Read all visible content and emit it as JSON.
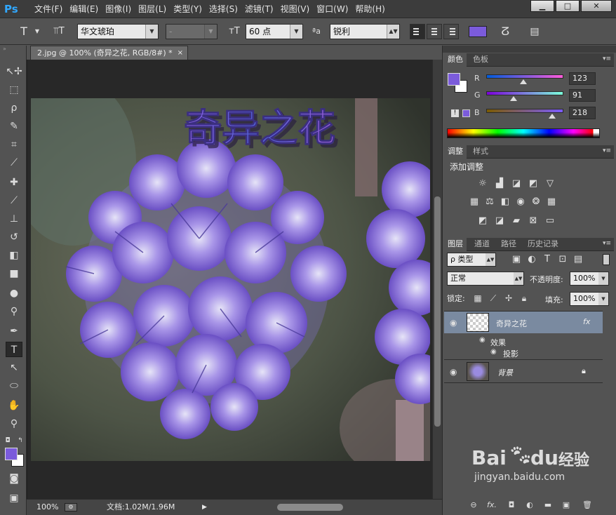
{
  "app": {
    "logo": "Ps"
  },
  "menu": [
    "文件(F)",
    "编辑(E)",
    "图像(I)",
    "图层(L)",
    "类型(Y)",
    "选择(S)",
    "滤镜(T)",
    "视图(V)",
    "窗口(W)",
    "帮助(H)"
  ],
  "window_controls": {
    "minimize": "▁",
    "maximize": "□",
    "close": "✕"
  },
  "options": {
    "tool_icon": "T",
    "font_family": "华文琥珀",
    "font_style": "-",
    "font_size": "60 点",
    "aa_label": "ªa",
    "antialias": "锐利",
    "text_color": "#7b5bdb"
  },
  "document": {
    "tab_title": "2.jpg @ 100% (奇异之花, RGB/8#) *",
    "close": "×",
    "overlay_text": "奇异之花"
  },
  "status": {
    "zoom": "100%",
    "doc_info": "文档:1.02M/1.96M"
  },
  "tools": [
    "move-icon",
    "marquee-icon",
    "lasso-icon",
    "quick-select-icon",
    "crop-icon",
    "eyedropper-icon",
    "healing-icon",
    "brush-icon",
    "stamp-icon",
    "history-brush-icon",
    "eraser-icon",
    "gradient-icon",
    "blur-icon",
    "dodge-icon",
    "pen-icon",
    "type-icon",
    "path-select-icon",
    "ellipse-icon",
    "hand-icon",
    "zoom-icon"
  ],
  "color_panel": {
    "tabs": [
      "颜色",
      "色板"
    ],
    "foreground": "#7b5bdb",
    "background": "#ffffff",
    "channels": [
      {
        "label": "R",
        "value": "123",
        "fraction": 0.482
      },
      {
        "label": "G",
        "value": "91",
        "fraction": 0.357
      },
      {
        "label": "B",
        "value": "218",
        "fraction": 0.855
      }
    ],
    "warning": "!"
  },
  "adjust_panel": {
    "tabs": [
      "调整",
      "样式"
    ],
    "title": "添加调整"
  },
  "layers_panel": {
    "tabs": [
      "图层",
      "通道",
      "路径",
      "历史记录"
    ],
    "filter": "ρ 类型",
    "blend_mode": "正常",
    "opacity_label": "不透明度:",
    "opacity": "100%",
    "lock_label": "锁定:",
    "fill_label": "填充:",
    "fill": "100%",
    "layers": [
      {
        "name": "奇异之花",
        "fx": "fx"
      },
      {
        "name": "背景"
      }
    ],
    "effects_label": "效果",
    "effect_name": "投影"
  },
  "watermark": {
    "brand": "Bai",
    "brand2": "du",
    "product": "经验",
    "url": "jingyan.baidu.com"
  }
}
